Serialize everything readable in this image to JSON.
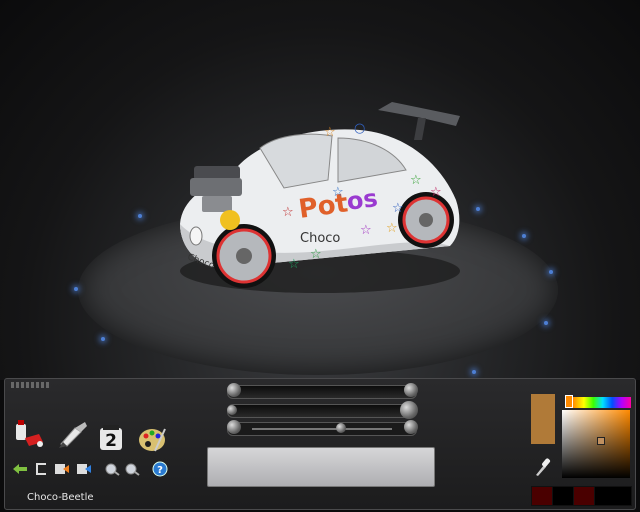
{
  "panel": {
    "car_name": "Choco-Beetle",
    "decal_text": "Choco"
  },
  "tools": [
    {
      "icon": "paint-spray-icon"
    },
    {
      "icon": "brush-hand-icon"
    },
    {
      "icon": "number-badge-icon",
      "label": "2"
    },
    {
      "icon": "palette-icon"
    }
  ],
  "mini_tools": [
    {
      "icon": "undo-arrow-icon"
    },
    {
      "icon": "layer-down-icon"
    },
    {
      "icon": "color-swap-icon"
    },
    {
      "icon": "redo-arrow-icon"
    },
    {
      "icon": "zoom-out-icon"
    },
    {
      "icon": "zoom-in-icon"
    },
    {
      "icon": "help-icon",
      "label": "?"
    }
  ],
  "sliders": [
    {
      "name": "size",
      "value": 1.0
    },
    {
      "name": "opacity",
      "value": 1.0
    },
    {
      "name": "rotation",
      "value": 0.62
    }
  ],
  "color": {
    "current": "#b07a38",
    "hue_marker": "#ff8a00",
    "recent": [
      "#4a0000",
      "#000000",
      "#4a0000",
      "#000000"
    ]
  }
}
